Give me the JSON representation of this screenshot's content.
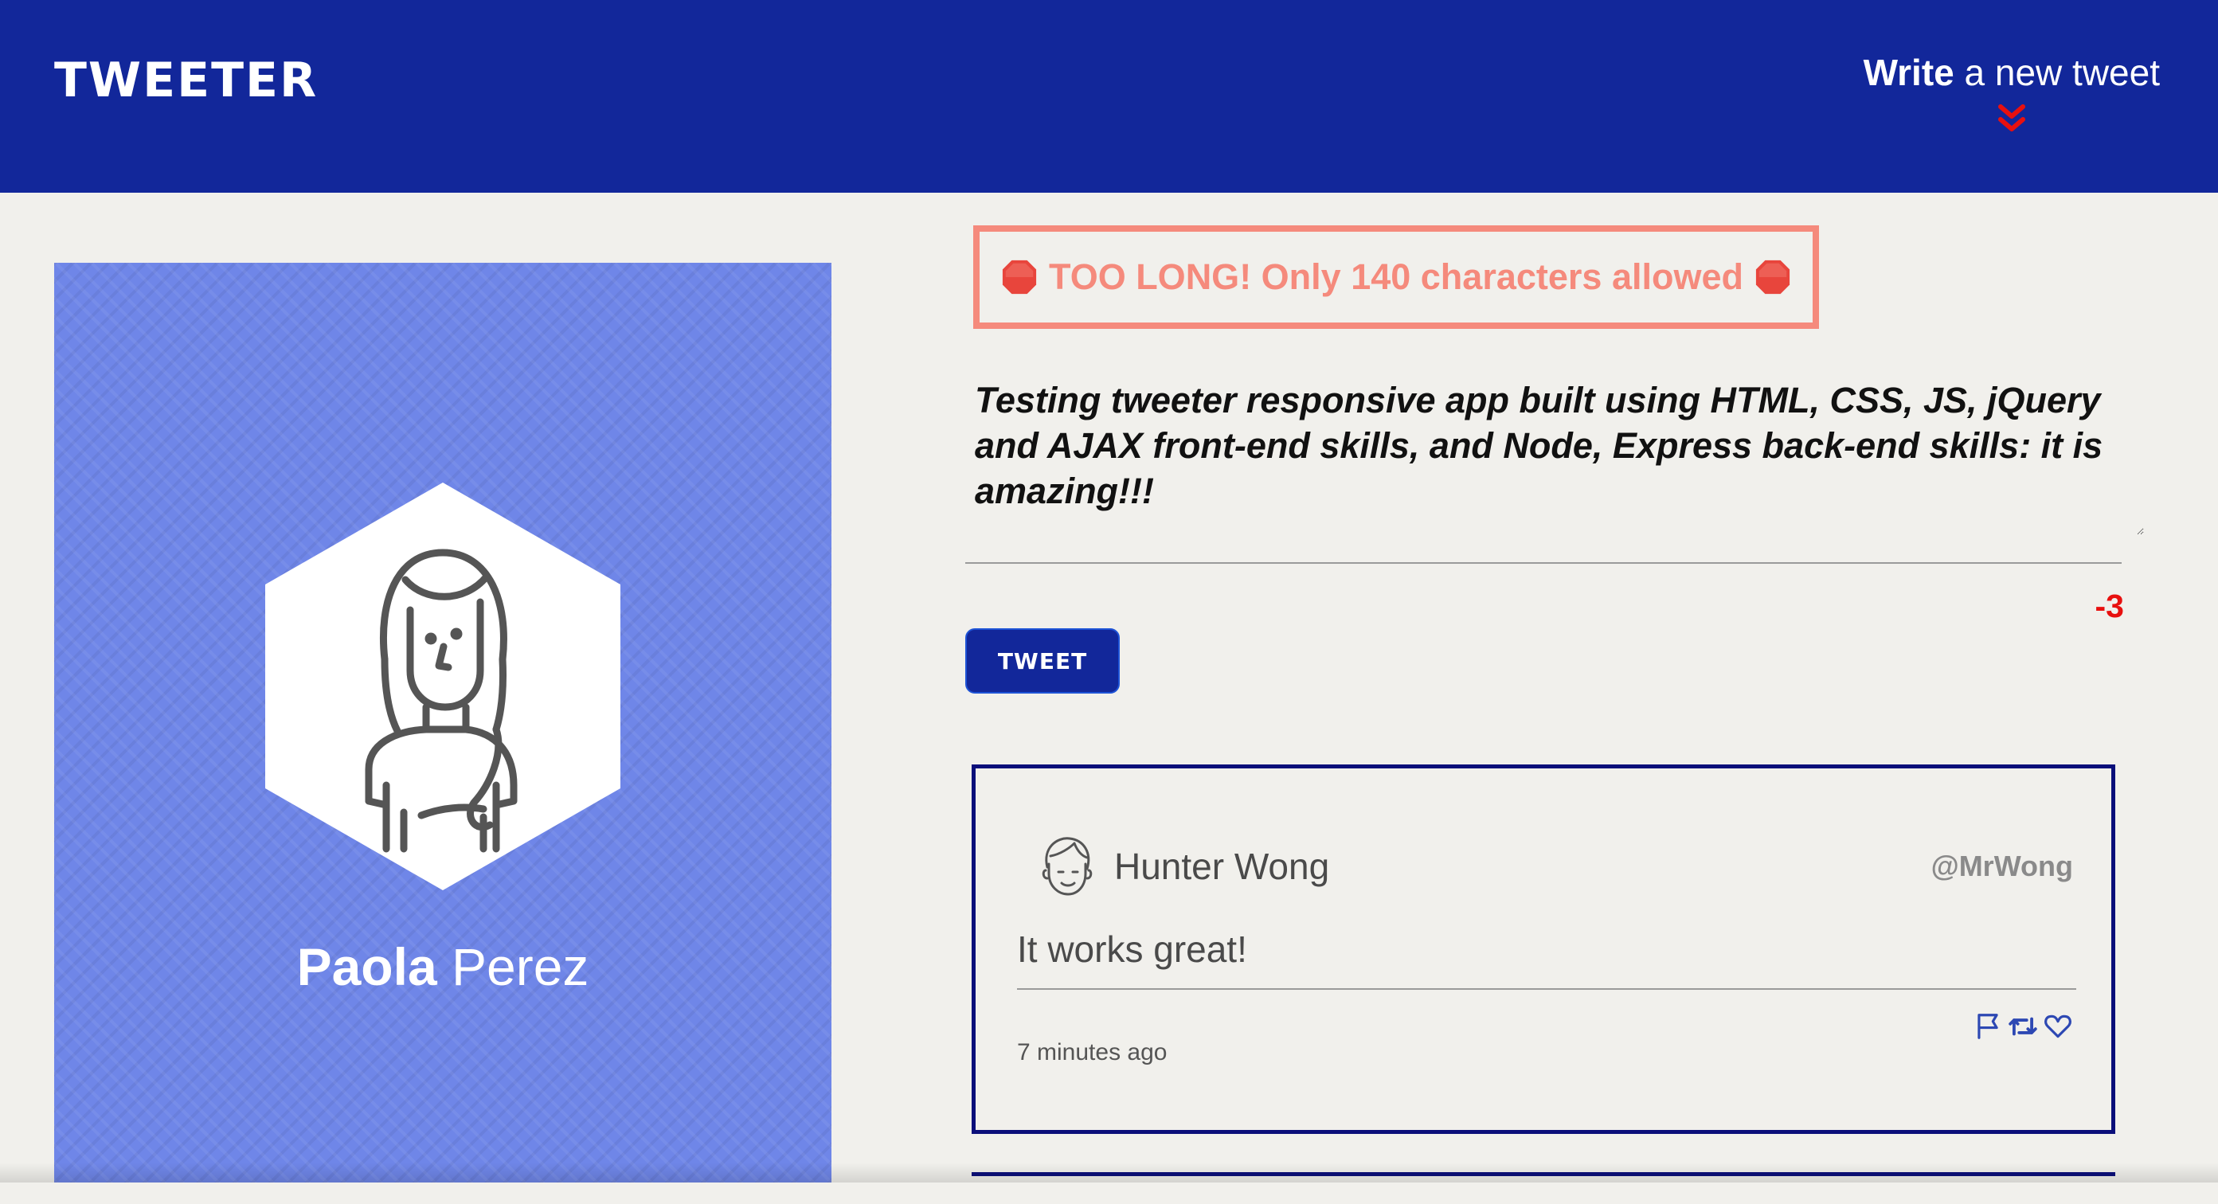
{
  "colors": {
    "navbar": "#12279a",
    "page_background": "#f1f0ec",
    "profile_background": "#6f86e8",
    "error": "#f58a7c",
    "counter_negative": "#e8100f",
    "tweet_border": "#0b0f7a",
    "icon_blue": "#2d48b3"
  },
  "navbar": {
    "brand": "TWEETER",
    "compose_bold": "Write",
    "compose_rest": " a new tweet",
    "compose_icon": "double-chevron-down-icon"
  },
  "profile": {
    "first_name": "Paola",
    "last_name": " Perez",
    "avatar_icon": "user-avatar-woman-icon"
  },
  "compose": {
    "error_message": "TOO LONG! Only 140 characters allowed",
    "error_icon": "stop-sign-icon",
    "tweet_text": "Testing tweeter responsive app built using HTML, CSS, JS, jQuery and AJAX front-end skills, and Node, Express back-end skills: it is amazing!!!",
    "counter": "-3",
    "button_label": "TWEET"
  },
  "tweets": [
    {
      "name": "Hunter Wong",
      "handle": "@MrWong",
      "text": "It works great!",
      "time": "7 minutes ago",
      "avatar_icon": "user-avatar-man-icon",
      "actions": [
        "flag-icon",
        "retweet-icon",
        "heart-icon"
      ]
    }
  ]
}
